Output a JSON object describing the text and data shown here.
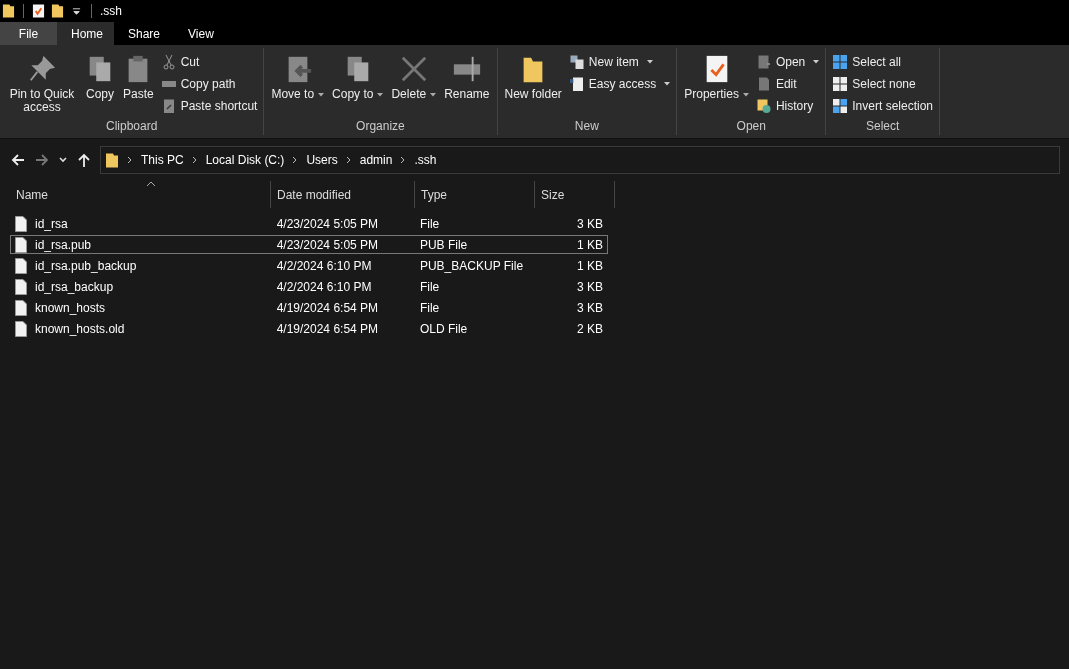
{
  "window": {
    "title": ".ssh"
  },
  "tabs": [
    {
      "label": "File",
      "kind": "file",
      "selected": false
    },
    {
      "label": "Home",
      "kind": "tab",
      "selected": true
    },
    {
      "label": "Share",
      "kind": "tab",
      "selected": false
    },
    {
      "label": "View",
      "kind": "tab",
      "selected": false
    }
  ],
  "ribbon": [
    {
      "label": "Clipboard",
      "buttons": [
        {
          "label": "Pin to Quick access",
          "kind": "large",
          "dropdown": false
        },
        {
          "label": "Copy",
          "kind": "large",
          "dropdown": false
        },
        {
          "label": "Paste",
          "kind": "large",
          "dropdown": false
        },
        {
          "label": "Cut",
          "kind": "small",
          "dropdown": false
        },
        {
          "label": "Copy path",
          "kind": "small",
          "dropdown": false
        },
        {
          "label": "Paste shortcut",
          "kind": "small",
          "dropdown": false
        }
      ]
    },
    {
      "label": "Organize",
      "buttons": [
        {
          "label": "Move to",
          "kind": "large",
          "dropdown": true
        },
        {
          "label": "Copy to",
          "kind": "large",
          "dropdown": true
        },
        {
          "label": "Delete",
          "kind": "large",
          "dropdown": true
        },
        {
          "label": "Rename",
          "kind": "large",
          "dropdown": false
        }
      ]
    },
    {
      "label": "New",
      "buttons": [
        {
          "label": "New folder",
          "kind": "large",
          "dropdown": false
        },
        {
          "label": "New item",
          "kind": "small",
          "dropdown": true
        },
        {
          "label": "Easy access",
          "kind": "small",
          "dropdown": true
        }
      ]
    },
    {
      "label": "Open",
      "buttons": [
        {
          "label": "Properties",
          "kind": "large",
          "dropdown": true
        },
        {
          "label": "Open",
          "kind": "small",
          "dropdown": true
        },
        {
          "label": "Edit",
          "kind": "small",
          "dropdown": false
        },
        {
          "label": "History",
          "kind": "small",
          "dropdown": false
        }
      ]
    },
    {
      "label": "Select",
      "buttons": [
        {
          "label": "Select all",
          "kind": "small",
          "dropdown": false
        },
        {
          "label": "Select none",
          "kind": "small",
          "dropdown": false
        },
        {
          "label": "Invert selection",
          "kind": "small",
          "dropdown": false
        }
      ]
    }
  ],
  "address": {
    "crumbs": [
      "This PC",
      "Local Disk (C:)",
      "Users",
      "admin",
      ".ssh"
    ]
  },
  "table": {
    "columns": [
      {
        "label": "Name",
        "sorted": true
      },
      {
        "label": "Date modified",
        "sorted": false
      },
      {
        "label": "Type",
        "sorted": false
      },
      {
        "label": "Size",
        "sorted": false
      }
    ],
    "rows": [
      {
        "name": "id_rsa",
        "date": "4/23/2024 5:05 PM",
        "type": "File",
        "size": "3 KB",
        "selected": false
      },
      {
        "name": "id_rsa.pub",
        "date": "4/23/2024 5:05 PM",
        "type": "PUB File",
        "size": "1 KB",
        "selected": true
      },
      {
        "name": "id_rsa.pub_backup",
        "date": "4/2/2024 6:10 PM",
        "type": "PUB_BACKUP File",
        "size": "1 KB",
        "selected": false
      },
      {
        "name": "id_rsa_backup",
        "date": "4/2/2024 6:10 PM",
        "type": "File",
        "size": "3 KB",
        "selected": false
      },
      {
        "name": "known_hosts",
        "date": "4/19/2024 6:54 PM",
        "type": "File",
        "size": "3 KB",
        "selected": false
      },
      {
        "name": "known_hosts.old",
        "date": "4/19/2024 6:54 PM",
        "type": "OLD File",
        "size": "2 KB",
        "selected": false
      }
    ]
  }
}
